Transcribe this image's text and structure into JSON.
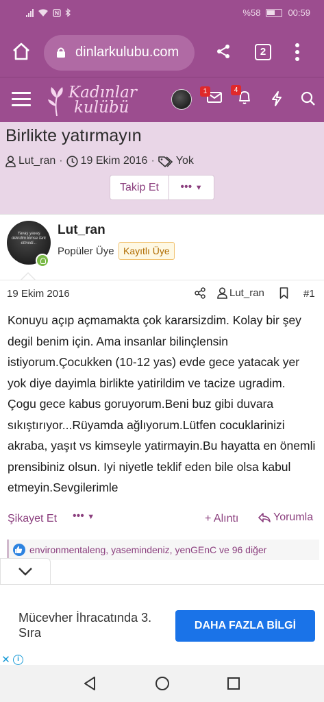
{
  "status_bar": {
    "battery": "%58",
    "time": "00:59"
  },
  "browser": {
    "url": "dinlarkulubu.com",
    "tab_count": "2"
  },
  "site": {
    "logo_line1": "Kadınlar",
    "logo_line2": "kulübü",
    "messages_badge": "1",
    "alerts_badge": "4"
  },
  "thread": {
    "title": "Birlikte yatırmayın",
    "author": "Lut_ran",
    "date": "19 Ekim 2016",
    "tags": "Yok",
    "follow_label": "Takip Et",
    "more_label": "•••"
  },
  "user": {
    "name": "Lut_ran",
    "title": "Popüler Üye",
    "banner": "Kayıtlı Üye",
    "avatar_text": "Yavaş yavaş delirdim kimse fark etmedi..."
  },
  "post": {
    "date": "19 Ekim 2016",
    "author": "Lut_ran",
    "number": "#1",
    "body": "Konuyu açıp açmamakta çok kararsizdim. Kolay bir şey degil benim için. Ama insanlar bilinçlensin istiyorum.Çocukken (10-12 yas) evde gece yatacak yer yok diye dayimla birlikte yatirildim ve tacize ugradim. Çogu gece kabus goruyorum.Beni buz gibi duvara sıkıştırıyor...Rüyamda ağlıyorum.Lütfen cocuklarinizi akraba, yaşıt vs kimseyle yatirmayin.Bu hayatta en önemli prensibiniz olsun. Iyi niyetle teklif eden bile olsa kabul etmeyin.Sevgilerimle",
    "report_label": "Şikayet Et",
    "more_label": "•••",
    "quote_label": "+ Alıntı",
    "reply_label": "Yorumla",
    "reactions": "environmentaleng, yasemindeniz, yenGEnC ve 96 diğer"
  },
  "ad": {
    "text": "Mücevher İhracatında 3. Sıra",
    "button": "DAHA FAZLA BİLGİ",
    "close": "✕",
    "info": "i"
  },
  "colors": {
    "brand": "#9c4d8f",
    "header_light": "#e9d6e7",
    "link": "#8b3f7e",
    "ad_button": "#1a73e8"
  }
}
